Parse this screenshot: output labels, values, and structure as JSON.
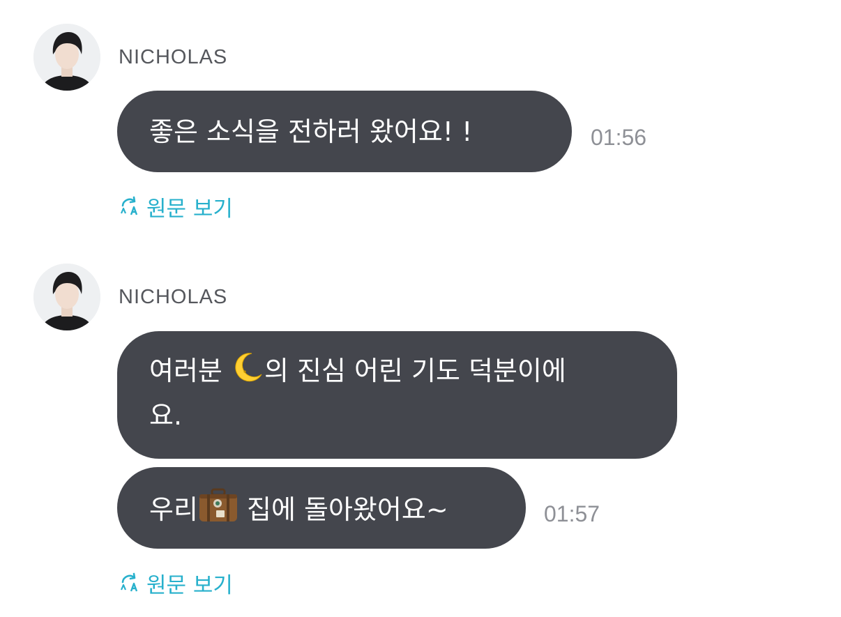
{
  "messages": [
    {
      "sender": "NICHOLAS",
      "bubbles": [
        {
          "text": "좋은 소식을 전하러 왔어요! !",
          "time": "01:56"
        }
      ],
      "translate_label": "원문 보기"
    },
    {
      "sender": "NICHOLAS",
      "bubbles": [
        {
          "text_line1_before": "여러분",
          "text_line1_after": "의 진심 어린 기도 덕분이에",
          "text_line2": "요.",
          "emoji": "crescent-moon"
        },
        {
          "text_before": "우리",
          "text_after": "집에 돌아왔어요~",
          "emoji": "suitcase",
          "time": "01:57"
        }
      ],
      "translate_label": "원문 보기"
    }
  ],
  "icons": {
    "translate": "translate-icon",
    "avatar": "avatar"
  },
  "colors": {
    "bubble": "#44464d",
    "bubble_text": "#ffffff",
    "sender": "#55575c",
    "time": "#8e9096",
    "translate_link": "#27b0cc"
  }
}
